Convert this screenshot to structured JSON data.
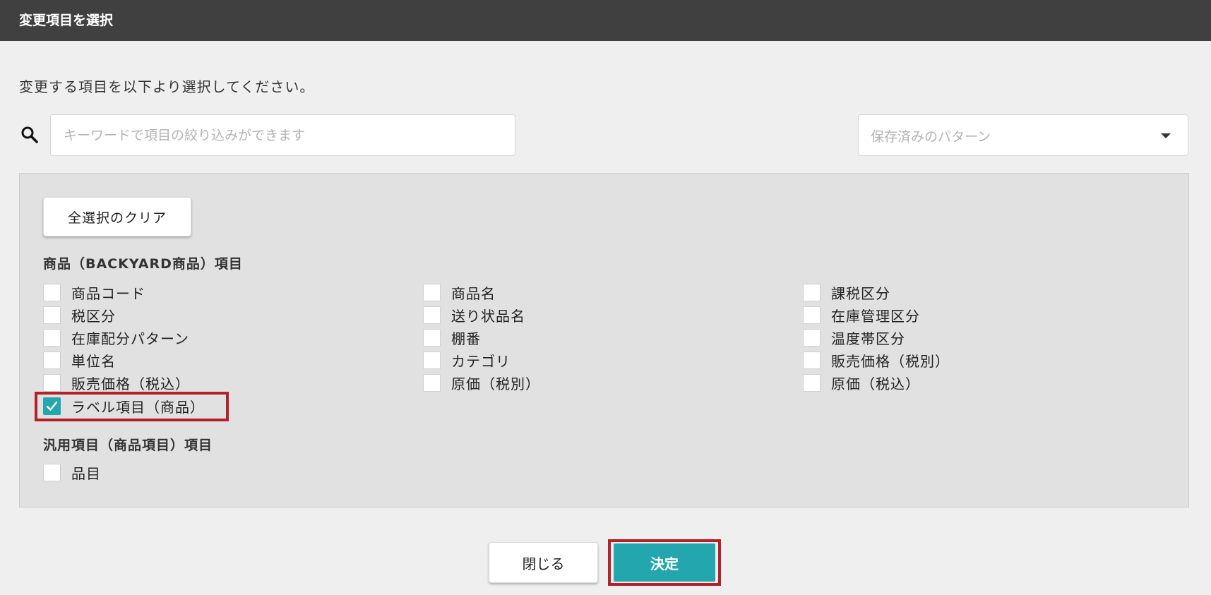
{
  "dialog": {
    "title": "変更項目を選択"
  },
  "instruction": "変更する項目を以下より選択してください。",
  "search": {
    "placeholder": "キーワードで項目の絞り込みができます",
    "value": ""
  },
  "pattern_select": {
    "placeholder": "保存済みのパターン"
  },
  "clear_button": "全選択のクリア",
  "sections": [
    {
      "heading": "商品（BACKYARD商品）項目",
      "items": [
        {
          "label": "商品コード",
          "checked": false
        },
        {
          "label": "商品名",
          "checked": false
        },
        {
          "label": "課税区分",
          "checked": false
        },
        {
          "label": "税区分",
          "checked": false
        },
        {
          "label": "送り状品名",
          "checked": false
        },
        {
          "label": "在庫管理区分",
          "checked": false
        },
        {
          "label": "在庫配分パターン",
          "checked": false
        },
        {
          "label": "棚番",
          "checked": false
        },
        {
          "label": "温度帯区分",
          "checked": false
        },
        {
          "label": "単位名",
          "checked": false
        },
        {
          "label": "カテゴリ",
          "checked": false
        },
        {
          "label": "販売価格（税別）",
          "checked": false
        },
        {
          "label": "販売価格（税込）",
          "checked": false
        },
        {
          "label": "原価（税別）",
          "checked": false
        },
        {
          "label": "原価（税込）",
          "checked": false
        },
        {
          "label": "ラベル項目（商品）",
          "checked": true
        }
      ]
    },
    {
      "heading": "汎用項目（商品項目）項目",
      "items": [
        {
          "label": "品目",
          "checked": false
        }
      ]
    }
  ],
  "footer": {
    "close_label": "閉じる",
    "decide_label": "決定"
  },
  "colors": {
    "accent": "#23a6ad",
    "titlebar": "#404040",
    "highlight": "#b3222a"
  }
}
